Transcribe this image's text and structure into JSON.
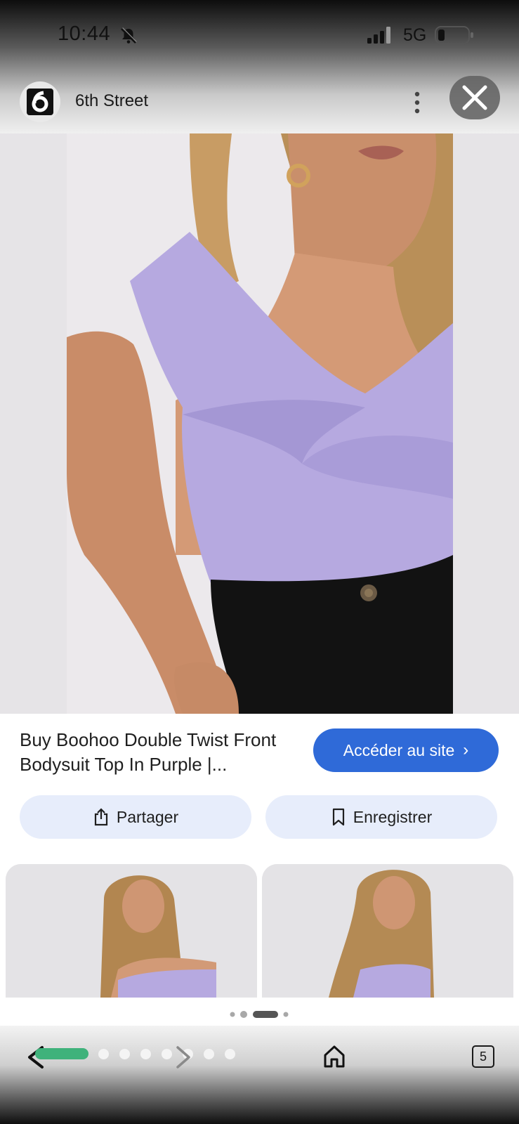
{
  "status_bar": {
    "time": "10:44",
    "network": "5G"
  },
  "source": {
    "name": "6th Street",
    "logo_text": "6"
  },
  "result": {
    "title": "Buy Boohoo Double Twist Front Bodysuit Top In Purple |...",
    "visit_label": "Accéder au site",
    "share_label": "Partager",
    "save_label": "Enregistrer"
  },
  "pager": {
    "count": 4,
    "active_index": 2
  },
  "bottom_bar": {
    "tab_count": "5",
    "step_dots": 7,
    "progress_active": 1
  },
  "colors": {
    "accent": "#2f6ad8",
    "pill_bg": "#e7edfb",
    "progress": "#3fb27b",
    "top_color": "#b6a9e0",
    "pants_color": "#121212",
    "background_image": "#e6e4e7"
  },
  "icons": {
    "bell": "bell-off-icon",
    "signal": "signal-icon",
    "battery": "battery-icon",
    "more": "more-vert-icon",
    "close": "close-icon",
    "share": "share-icon",
    "save": "bookmark-icon",
    "back": "chevron-left-icon",
    "forward": "chevron-right-icon",
    "home": "home-icon"
  }
}
